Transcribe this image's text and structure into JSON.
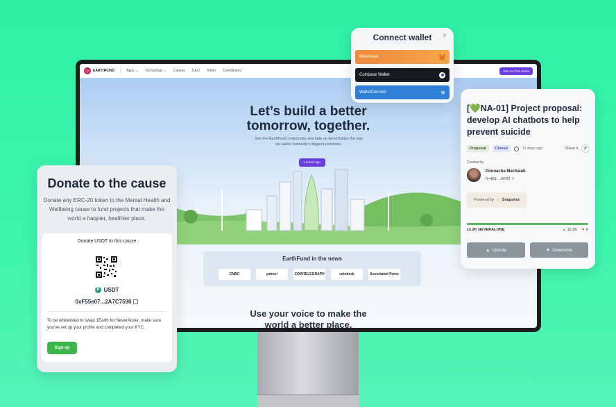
{
  "app": {
    "nav": {
      "brand": "EARTHFUND",
      "links": [
        "Apps ⌄",
        "Technology ⌄",
        "Causes",
        "DAO",
        "Token",
        "Contributors"
      ],
      "cta": "Join our first cause"
    },
    "hero": {
      "title_line1": "Let’s build a better",
      "title_line2": "tomorrow, together.",
      "subtitle": "Join the EarthFund community and help us decentralize the way we tackle humanity's biggest problems.",
      "button": "Launch app"
    },
    "news": {
      "title": "EarthFund in the news",
      "logos": [
        "CNBC",
        "yahoo!",
        "COINTELEGRAPH",
        "coindesk",
        "Associated Press"
      ]
    },
    "voice": {
      "line1": "Use your voice to make the",
      "line2": "world a better place."
    }
  },
  "connect_wallet": {
    "title": "Connect wallet",
    "close": "×",
    "wallets": [
      {
        "label": "Metamask",
        "icon": "metamask-fox-icon"
      },
      {
        "label": "Coinbase Wallet",
        "icon": "coinbase-icon"
      },
      {
        "label": "WalletConnect",
        "icon": "walletconnect-icon"
      }
    ]
  },
  "donate": {
    "title": "Donate to the cause",
    "description": "Donate any ERC-20 token to the Mental Health and Wellbeing cause to fund projects that make the world a happier, healthier place.",
    "subtitle": "Donate USDT to this cause",
    "token": "USDT",
    "address": "0xF55e07...2A7C7590",
    "note": "To be whitelisted to swap 1Earth for NeverAlone, make sure you've set up your profile and completed your KYC.",
    "signup": "Sign up"
  },
  "proposal": {
    "title": "[💚NA-01] Project proposal: develop AI chatbots to help prevent suicide",
    "tag_type": "Proposal",
    "tag_status": "Closed",
    "age": "11 days ago",
    "share": "Share it",
    "created_by_label": "Created by",
    "author_name": "Poonacha Machaiah",
    "author_address": "0×4B1....AF62",
    "powered_by": "Powered by",
    "powered_name": "Snapshot",
    "result_label": "12.2K NEVERALONE",
    "up_count": "12.2K",
    "down_count": "0",
    "upvote": "Upvote",
    "downvote": "Downvote",
    "progress": 1.0
  },
  "colors": {
    "background": "#3ff5ae",
    "accent_purple": "#6a3fe0",
    "signup_green": "#3db54a",
    "metamask": "#f08a3c",
    "coinbase": "#171a20",
    "walletconnect": "#2f7fd6"
  }
}
